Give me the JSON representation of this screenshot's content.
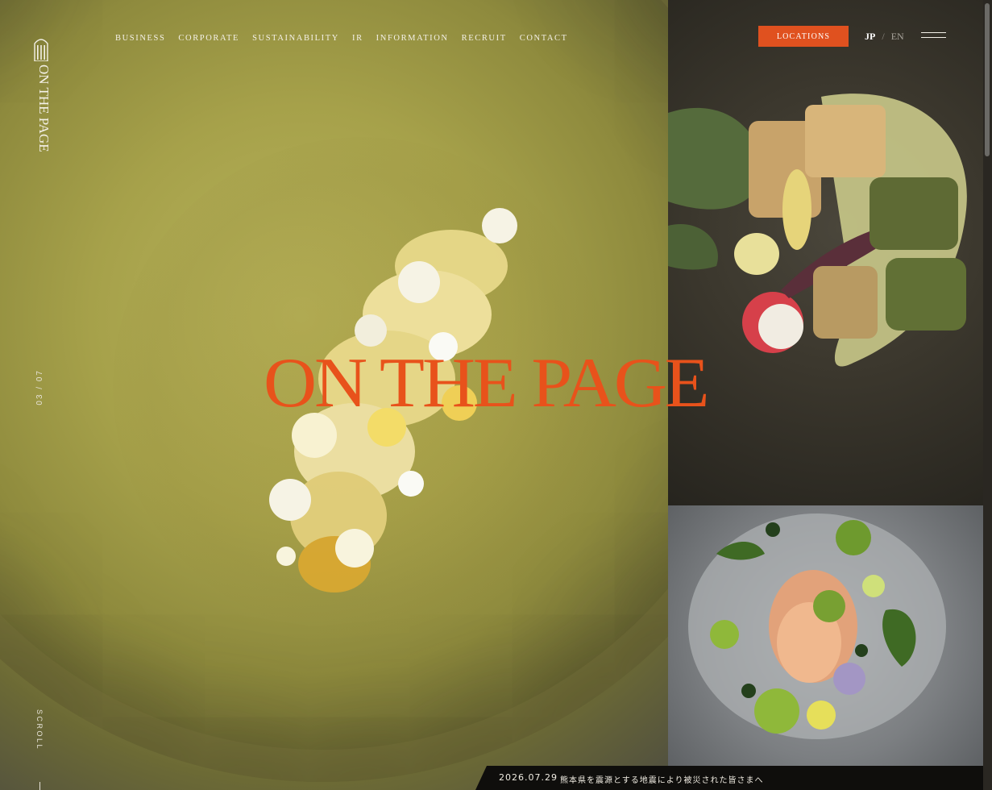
{
  "brand": {
    "name": "ON THE PAGE",
    "logo_icon": "building-columns-icon"
  },
  "nav": {
    "items": [
      {
        "label": "BUSINESS"
      },
      {
        "label": "CORPORATE"
      },
      {
        "label": "SUSTAINABILITY"
      },
      {
        "label": "IR"
      },
      {
        "label": "INFORMATION"
      },
      {
        "label": "RECRUIT"
      },
      {
        "label": "CONTACT"
      }
    ],
    "locations_label": "LOCATIONS",
    "lang_jp": "JP",
    "lang_separator": "/",
    "lang_en": "EN",
    "menu_icon": "hamburger-menu-icon"
  },
  "hero": {
    "title": "ON THE PAGE",
    "slide_counter": "03 / 07",
    "scroll_label": "SCROLL"
  },
  "news": {
    "date": "2026.07.29",
    "title": "熊本県を震源とする地震により被災された皆さまへ"
  },
  "colors": {
    "accent": "#e0511f",
    "title": "#e8521b",
    "news_bg": "#0f0e0c"
  }
}
